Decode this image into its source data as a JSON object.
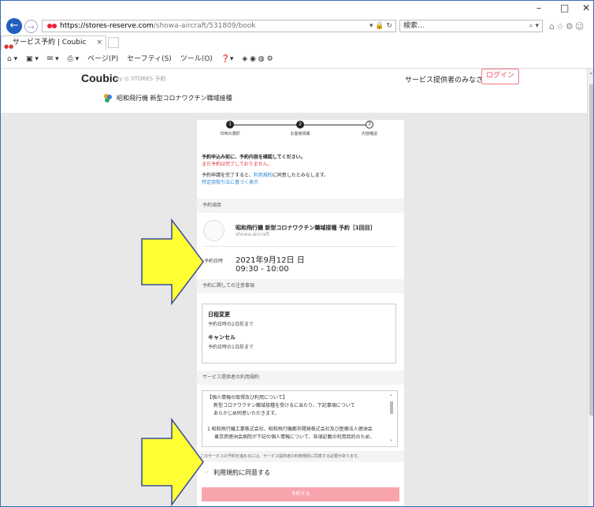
{
  "browser": {
    "url_host": "https://stores-reserve.com",
    "url_path": "/showa-aircraft/531809/book",
    "search_placeholder": "検索...",
    "tab_title": "サービス予約 | Coubic",
    "cmd_items": [
      "ページ(P)",
      "セーフティ(S)",
      "ツール(O)"
    ]
  },
  "header": {
    "logo": "Coubic",
    "logo_by": "by ◎ STORES 予約",
    "providers_link": "サービス提供者のみなさま",
    "login_label": "ログイン",
    "store_name": "昭和飛行機 新型コロナワクチン職域接種"
  },
  "steps": [
    {
      "num": "1",
      "label": "日時の選択"
    },
    {
      "num": "2",
      "label": "お客様情報"
    },
    {
      "num": "3",
      "label": "内容確認"
    }
  ],
  "notice": {
    "line1": "予約申込み前に、予約内容を確認してください。",
    "line2": "まだ予約は完了しておりません。",
    "line3_pre": "予約申請を完了すると、",
    "line3_link": "利用規約",
    "line3_post": "に同意したとみなします。",
    "line4": "特定商取引法に基づく表示"
  },
  "reservation": {
    "section_label": "予約項目",
    "title": "昭和飛行機 新型コロナワクチン職域接種 予約［1回目］",
    "store": "showa-aircraft",
    "datetime_label": "予約日時",
    "date": "2021年9月12日 日",
    "time": "09:30 - 10:00"
  },
  "policy": {
    "section_label": "予約に関しての注意事項",
    "change_heading": "日程変更",
    "change_text": "予約日時の2日前まで",
    "cancel_heading": "キャンセル",
    "cancel_text": "予約日時の1日前まで"
  },
  "terms": {
    "section_label": "サービス提供者の利用規約",
    "l1": "【個人情報の取得及び利用について】",
    "l2": "新型コロナワクチン職域接種を受けるに当たり、下記事項について",
    "l3": "あらかじめ同意いただきます。",
    "l4": "1 昭和飛行機工業株式会社、昭和飛行機都市開発株式会社及び医療法人徳洲会",
    "l5": "東京西徳洲会病院が下記の個人情報について、各項記載の利用目的のため、",
    "note": "このサービスの予約を進めるには、サービス提供者の利用規約に同意する必要があります。",
    "agree_label": "利用規約に同意する"
  },
  "submit_label": "予約する",
  "colors": {
    "accent": "#f05065",
    "link": "#2b87d8",
    "arrow_fill": "#ffff33",
    "arrow_stroke": "#3a4a9a"
  }
}
